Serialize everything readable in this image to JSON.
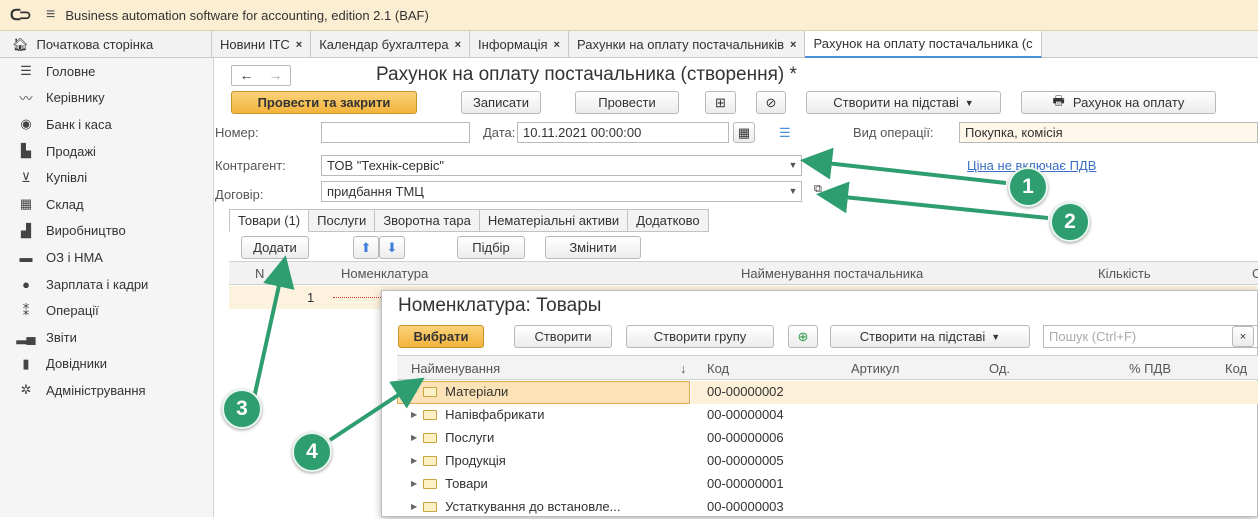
{
  "titlebar": {
    "title": "Business automation software for accounting, edition 2.1  (BAF)"
  },
  "tabs": [
    {
      "label": "Початкова сторінка"
    },
    {
      "label": "Новини ІТС"
    },
    {
      "label": "Календар бухгалтера"
    },
    {
      "label": "Інформація"
    },
    {
      "label": "Рахунки на оплату постачальників"
    },
    {
      "label": "Рахунок на оплату постачальника (с"
    }
  ],
  "sidebar": {
    "items": [
      {
        "label": "Головне",
        "icon": "menu-icon"
      },
      {
        "label": "Керівнику",
        "icon": "chart-line-icon"
      },
      {
        "label": "Банк і каса",
        "icon": "bank-icon"
      },
      {
        "label": "Продажі",
        "icon": "sales-icon"
      },
      {
        "label": "Купівлі",
        "icon": "cart-icon"
      },
      {
        "label": "Склад",
        "icon": "warehouse-icon"
      },
      {
        "label": "Виробництво",
        "icon": "factory-icon"
      },
      {
        "label": "ОЗ і НМА",
        "icon": "truck-icon"
      },
      {
        "label": "Зарплата і кадри",
        "icon": "person-icon"
      },
      {
        "label": "Операції",
        "icon": "operations-icon"
      },
      {
        "label": "Звіти",
        "icon": "reports-icon"
      },
      {
        "label": "Довідники",
        "icon": "book-icon"
      },
      {
        "label": "Адміністрування",
        "icon": "gear-icon"
      }
    ]
  },
  "form": {
    "title": "Рахунок на оплату постачальника (створення) *",
    "toolbar": {
      "post_close": "Провести та закрити",
      "save": "Записати",
      "post": "Провести",
      "create_based": "Створити на підставі",
      "print_invoice": "Рахунок на оплату"
    },
    "number_label": "Номер:",
    "number_value": "",
    "date_label": "Дата:",
    "date_value": "10.11.2021 00:00:00",
    "operation_label": "Вид операції:",
    "operation_value": "Покупка, комісія",
    "counterparty_label": "Контрагент:",
    "counterparty_value": "ТОВ \"Технік-сервіс\"",
    "vat_link": "Ціна не включає ПДВ",
    "contract_label": "Договір:",
    "contract_value": "придбання ТМЦ",
    "tabs": [
      "Товари (1)",
      "Послуги",
      "Зворотна тара",
      "Нематеріальні активи",
      "Додатково"
    ],
    "table_toolbar": {
      "add": "Додати",
      "pick": "Підбір",
      "change": "Змінити"
    },
    "columns": {
      "n": "N",
      "item": "Номенклатура",
      "supplier_name": "Найменування постачальника",
      "qty": "Кількість",
      "c": "С"
    },
    "rows": [
      {
        "n": "1"
      }
    ]
  },
  "popup": {
    "title": "Номенклатура: Товары",
    "select": "Вибрати",
    "create": "Створити",
    "create_group": "Створити групу",
    "create_based": "Створити на підставі",
    "search_placeholder": "Пошук (Ctrl+F)",
    "columns": {
      "name": "Найменування",
      "code": "Код",
      "article": "Артикул",
      "unit": "Од.",
      "vat": "% ПДВ",
      "code2": "Код"
    },
    "rows": [
      {
        "name": "Матеріали",
        "code": "00-00000002"
      },
      {
        "name": "Напівфабрикати",
        "code": "00-00000004"
      },
      {
        "name": "Послуги",
        "code": "00-00000006"
      },
      {
        "name": "Продукція",
        "code": "00-00000005"
      },
      {
        "name": "Товари",
        "code": "00-00000001"
      },
      {
        "name": "Устаткування до встановле...",
        "code": "00-00000003"
      }
    ]
  },
  "callouts": [
    "1",
    "2",
    "3",
    "4"
  ],
  "colors": {
    "accent": "#f3b33b",
    "callout": "#2e9e71",
    "link": "#3a6fc3"
  }
}
